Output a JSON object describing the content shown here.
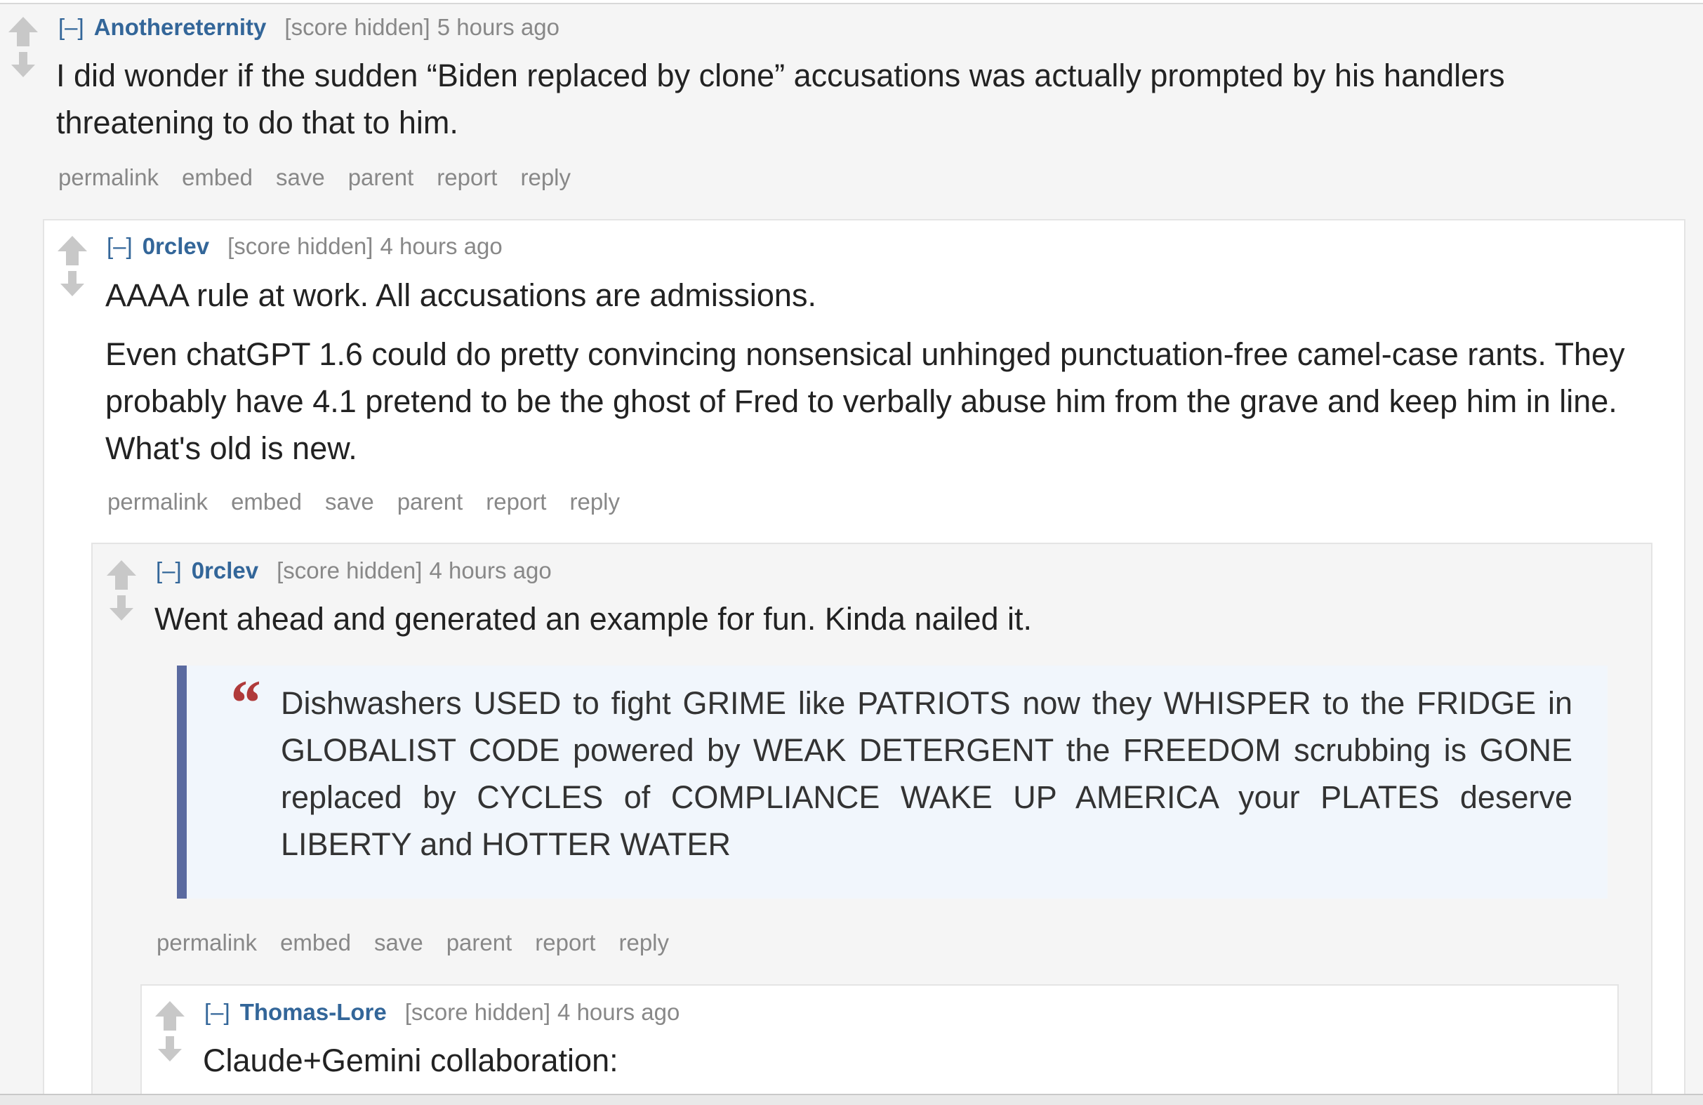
{
  "icons": {
    "upvote": "arrow-up-icon",
    "downvote": "arrow-down-icon",
    "quote": "quote-mark-icon"
  },
  "colors": {
    "author": "#336699",
    "quote_bar": "#5a6aa0",
    "quote_mark": "#b03a3a",
    "muted": "#888888"
  },
  "comments": [
    {
      "expand": "[–]",
      "author": "Anothereternity",
      "score": "[score hidden]",
      "time": "5 hours ago",
      "paragraphs": [
        "I did wonder if the sudden “Biden replaced by clone” accusations was actually prompted by his handlers threatening to do that to him."
      ],
      "buttons": [
        "permalink",
        "embed",
        "save",
        "parent",
        "report",
        "reply"
      ]
    },
    {
      "expand": "[–]",
      "author": "0rclev",
      "score": "[score hidden]",
      "time": "4 hours ago",
      "paragraphs": [
        "AAAA rule at work. All accusations are admissions.",
        "Even chatGPT 1.6 could do pretty convincing nonsensical unhinged punctuation-free camel-case rants. They probably have 4.1 pretend to be the ghost of Fred to verbally abuse him from the grave and keep him in line. What's old is new."
      ],
      "buttons": [
        "permalink",
        "embed",
        "save",
        "parent",
        "report",
        "reply"
      ]
    },
    {
      "expand": "[–]",
      "author": "0rclev",
      "score": "[score hidden]",
      "time": "4 hours ago",
      "paragraphs": [
        "Went ahead and generated an example for fun. Kinda nailed it."
      ],
      "quote": "Dishwashers USED to fight GRIME like PATRIOTS now they WHISPER to the FRIDGE in GLOBALIST CODE powered by WEAK DETERGENT the FREEDOM scrubbing is GONE replaced by CYCLES of COMPLIANCE WAKE UP AMERICA your PLATES deserve LIBERTY and HOTTER WATER",
      "buttons": [
        "permalink",
        "embed",
        "save",
        "parent",
        "report",
        "reply"
      ]
    },
    {
      "expand": "[–]",
      "author": "Thomas-Lore",
      "score": "[score hidden]",
      "time": "4 hours ago",
      "paragraphs": [
        "Claude+Gemini collaboration:"
      ]
    }
  ]
}
